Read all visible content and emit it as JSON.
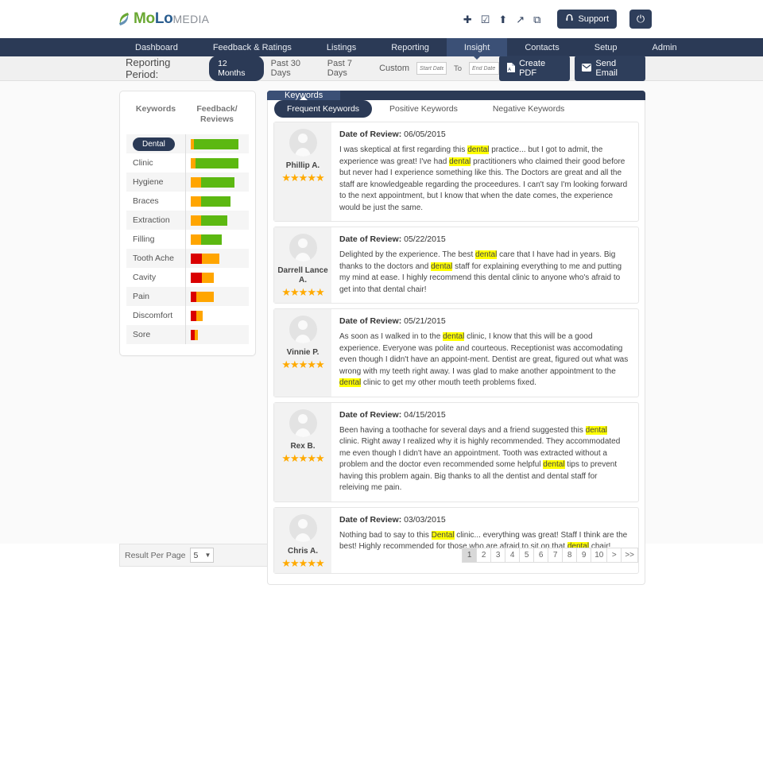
{
  "header": {
    "logo": {
      "mo": "MoLo",
      "mo_part": "Mo",
      "lo_part": "Lo",
      "media": "MEDIA"
    },
    "icons": [
      {
        "name": "add-icon",
        "glyph": "✚"
      },
      {
        "name": "edit-icon",
        "glyph": "☑"
      },
      {
        "name": "upload-icon",
        "glyph": "⬆"
      },
      {
        "name": "external-link-icon",
        "glyph": "↗"
      },
      {
        "name": "new-window-icon",
        "glyph": "⧉"
      }
    ],
    "support_label": "Support",
    "power_glyph": "⏻"
  },
  "nav": {
    "items": [
      {
        "label": "Dashboard",
        "active": false
      },
      {
        "label": "Feedback & Ratings",
        "active": false
      },
      {
        "label": "Listings",
        "active": false
      },
      {
        "label": "Reporting",
        "active": false
      },
      {
        "label": "Insight",
        "active": true
      },
      {
        "label": "Contacts",
        "active": false
      },
      {
        "label": "Setup",
        "active": false
      },
      {
        "label": "Admin",
        "active": false
      }
    ]
  },
  "period_bar": {
    "title": "Reporting Period:",
    "options": [
      {
        "label": "12 Months",
        "active": true
      },
      {
        "label": "Past 30 Days",
        "active": false
      },
      {
        "label": "Past 7 Days",
        "active": false
      },
      {
        "label": "Custom",
        "active": false
      }
    ],
    "start_date_placeholder": "Start Date",
    "to_label": "To",
    "end_date_placeholder": "End Date",
    "create_pdf_label": "Create PDF",
    "send_email_label": "Send Email"
  },
  "keywords_panel": {
    "col_keywords": "Keywords",
    "col_feedback": "Feedback/\nReviews",
    "col_feedback_l1": "Feedback/",
    "col_feedback_l2": "Reviews",
    "rows": [
      {
        "label": "Dental",
        "selected": true,
        "red": 0,
        "orange": 4,
        "green": 56
      },
      {
        "label": "Clinic",
        "selected": false,
        "red": 0,
        "orange": 6,
        "green": 54
      },
      {
        "label": "Hygiene",
        "selected": false,
        "red": 0,
        "orange": 13,
        "green": 42
      },
      {
        "label": "Braces",
        "selected": false,
        "red": 0,
        "orange": 13,
        "green": 37
      },
      {
        "label": "Extraction",
        "selected": false,
        "red": 0,
        "orange": 13,
        "green": 33
      },
      {
        "label": "Filling",
        "selected": false,
        "red": 0,
        "orange": 13,
        "green": 26
      },
      {
        "label": "Tooth Ache",
        "selected": false,
        "red": 14,
        "orange": 22,
        "green": 0
      },
      {
        "label": "Cavity",
        "selected": false,
        "red": 14,
        "orange": 15,
        "green": 0
      },
      {
        "label": "Pain",
        "selected": false,
        "red": 7,
        "orange": 22,
        "green": 0
      },
      {
        "label": "Discomfort",
        "selected": false,
        "red": 7,
        "orange": 8,
        "green": 0
      },
      {
        "label": "Sore",
        "selected": false,
        "red": 5,
        "orange": 4,
        "green": 0
      }
    ]
  },
  "tabs": {
    "main": "Keywords",
    "sub": [
      {
        "label": "Frequent Keywords",
        "active": true
      },
      {
        "label": "Positive Keywords",
        "active": false
      },
      {
        "label": "Negative Keywords",
        "active": false
      }
    ]
  },
  "reviews": {
    "date_label": "Date of Review:",
    "items": [
      {
        "name": "Phillip A.",
        "date": "06/05/2015",
        "stars": 5,
        "parts": [
          {
            "t": "I was skeptical at first regarding this "
          },
          {
            "t": "dental",
            "hl": true
          },
          {
            "t": " practice... but I got to admit, the experience was great! I've had "
          },
          {
            "t": "dental",
            "hl": true
          },
          {
            "t": " practitioners who claimed their good before but never had I experience something like this. The Doctors are great and all the staff are knowledgeable regarding the proceedures. I can't say I'm looking forward to the next appointment, but I know that when the date comes, the experience would be just the same."
          }
        ]
      },
      {
        "name": "Darrell Lance A.",
        "date": "05/22/2015",
        "stars": 5,
        "parts": [
          {
            "t": "Delighted by the experience. The best "
          },
          {
            "t": "dental",
            "hl": true
          },
          {
            "t": " care that I have had in years. Big thanks to the doctors and "
          },
          {
            "t": "dental",
            "hl": true
          },
          {
            "t": " staff for explaining everything to me and putting my mind at ease. I highly recommend this dental clinic to anyone who's afraid to get into that dental chair!"
          }
        ]
      },
      {
        "name": "Vinnie P.",
        "date": "05/21/2015",
        "stars": 5,
        "parts": [
          {
            "t": "As soon as I walked in to the "
          },
          {
            "t": "dental",
            "hl": true
          },
          {
            "t": " clinic, I know that this will be a good experience. Everyone was polite and courteous. Receptionist was accomodating even though I didn't have an appoint-ment. Dentist are great, figured out what was wrong with my teeth right away. I was glad to make another appointment to the "
          },
          {
            "t": "dental",
            "hl": true
          },
          {
            "t": " clinic to get my other mouth teeth problems fixed."
          }
        ]
      },
      {
        "name": "Rex B.",
        "date": "04/15/2015",
        "stars": 5,
        "parts": [
          {
            "t": "Been having a toothache for several days and a friend suggested this "
          },
          {
            "t": "dental",
            "hl": true
          },
          {
            "t": " clinic. Right away I realized why it is highly recommended. They accommodated me even though I didn't have an appointment. Tooth was extracted without a problem and the doctor even recommended some helpful "
          },
          {
            "t": "dental",
            "hl": true
          },
          {
            "t": " tips to prevent having this problem again. Big thanks to all the dentist and dental staff for releiving me pain."
          }
        ]
      },
      {
        "name": "Chris A.",
        "date": "03/03/2015",
        "stars": 5,
        "parts": [
          {
            "t": "Nothing bad to say to this "
          },
          {
            "t": "Dental",
            "hl": true
          },
          {
            "t": " clinic... everything was great! Staff I think are the best! Highly recommended for those who are afraid to sit on that "
          },
          {
            "t": "dental",
            "hl": true
          },
          {
            "t": " chair!"
          }
        ]
      }
    ]
  },
  "footer": {
    "result_per_page_label": "Result Per Page",
    "result_per_page_value": "5",
    "pages": [
      {
        "label": "1",
        "active": true
      },
      {
        "label": "2",
        "active": false
      },
      {
        "label": "3",
        "active": false
      },
      {
        "label": "4",
        "active": false
      },
      {
        "label": "5",
        "active": false
      },
      {
        "label": "6",
        "active": false
      },
      {
        "label": "7",
        "active": false
      },
      {
        "label": "8",
        "active": false
      },
      {
        "label": "9",
        "active": false
      },
      {
        "label": "10",
        "active": false
      },
      {
        "label": ">",
        "active": false
      },
      {
        "label": ">>",
        "active": false
      }
    ]
  },
  "colors": {
    "navy": "#2b3a56",
    "navy_light": "#3b5076",
    "green": "#5cb811",
    "orange": "#ffa500",
    "red": "#da0000",
    "highlight": "#ffff00",
    "star": "#ffaa00"
  }
}
